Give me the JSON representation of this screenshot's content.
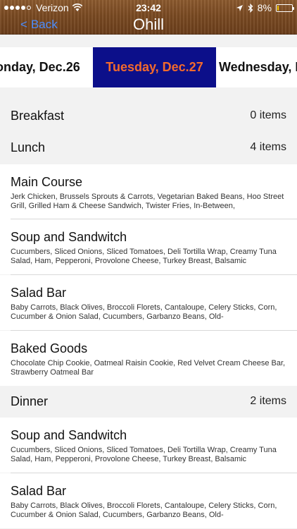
{
  "status": {
    "carrier": "Verizon",
    "time": "23:42",
    "battery_pct": "8%",
    "battery_level": 0.08
  },
  "nav": {
    "back_label": "Back",
    "title": "Ohill"
  },
  "days": {
    "prev": "onday, Dec.26",
    "selected": "Tuesday, Dec.27",
    "next": "Wednesday, I"
  },
  "sections": [
    {
      "label": "Breakfast",
      "count": "0 items"
    },
    {
      "label": "Lunch",
      "count": "4 items"
    },
    {
      "label": "Dinner",
      "count": "2 items"
    }
  ],
  "lunch_items": [
    {
      "name": "Main Course",
      "desc": "Jerk Chicken, Brussels Sprouts & Carrots, Vegetarian Baked Beans, Hoo Street Grill, Grilled Ham & Cheese Sandwich, Twister Fries, In-Between,"
    },
    {
      "name": "Soup and Sandwitch",
      "desc": "Cucumbers, Sliced Onions, Sliced Tomatoes, Deli Tortilla Wrap, Creamy Tuna Salad, Ham, Pepperoni, Provolone Cheese, Turkey Breast, Balsamic"
    },
    {
      "name": "Salad Bar",
      "desc": "Baby Carrots, Black Olives, Broccoli Florets, Cantaloupe, Celery Sticks, Corn, Cucumber & Onion Salad, Cucumbers, Garbanzo Beans, Old-"
    },
    {
      "name": "Baked Goods",
      "desc": "Chocolate Chip Cookie, Oatmeal Raisin Cookie, Red Velvet Cream Cheese Bar, Strawberry Oatmeal Bar"
    }
  ],
  "dinner_items": [
    {
      "name": "Soup and Sandwitch",
      "desc": "Cucumbers, Sliced Onions, Sliced Tomatoes, Deli Tortilla Wrap, Creamy Tuna Salad, Ham, Pepperoni, Provolone Cheese, Turkey Breast, Balsamic"
    },
    {
      "name": "Salad Bar",
      "desc": "Baby Carrots, Black Olives, Broccoli Florets, Cantaloupe, Celery Sticks, Corn, Cucumber & Onion Salad, Cucumbers, Garbanzo Beans, Old-"
    }
  ],
  "colors": {
    "accent_back": "#4a8dff",
    "selected_bg": "#0c0f8a",
    "selected_text": "#f36a2c"
  },
  "icons": [
    "wifi-icon",
    "location-icon",
    "bluetooth-icon",
    "battery-icon",
    "back-chevron-icon"
  ]
}
